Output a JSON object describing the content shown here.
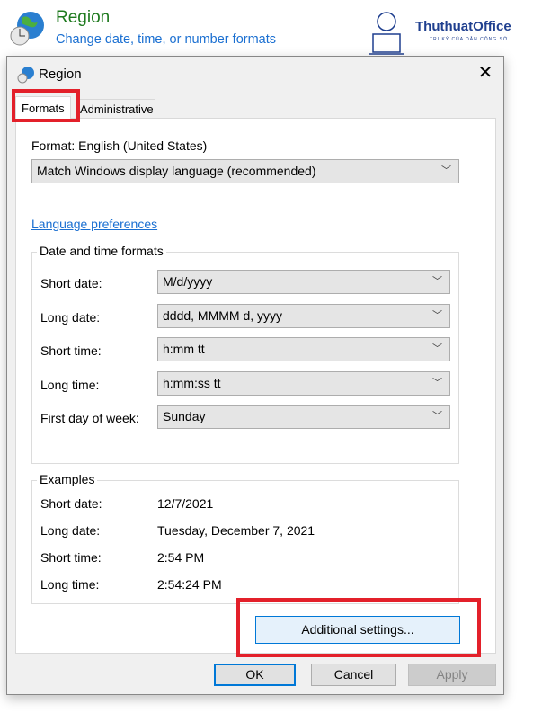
{
  "header": {
    "title": "Region",
    "subtitle": "Change date, time, or number formats",
    "icon": "globe-clock-icon"
  },
  "watermark": {
    "name": "ThuthuatOffice",
    "tagline": "TRI KỶ CỦA DÂN CÔNG SỞ"
  },
  "dialog": {
    "title": "Region",
    "close": "✕",
    "tabs": [
      {
        "label": "Formats",
        "active": true
      },
      {
        "label": "Administrative"
      }
    ],
    "format_label": "Format: English (United States)",
    "format_value": "Match Windows display language (recommended)",
    "language_link": "Language preferences",
    "date_time": {
      "title": "Date and time formats",
      "rows": [
        {
          "label": "Short date:",
          "value": "M/d/yyyy"
        },
        {
          "label": "Long date:",
          "value": "dddd, MMMM d, yyyy"
        },
        {
          "label": "Short time:",
          "value": "h:mm tt"
        },
        {
          "label": "Long time:",
          "value": "h:mm:ss tt"
        },
        {
          "label": "First day of week:",
          "value": "Sunday"
        }
      ]
    },
    "examples": {
      "title": "Examples",
      "rows": [
        {
          "label": "Short date:",
          "value": "12/7/2021"
        },
        {
          "label": "Long date:",
          "value": "Tuesday, December 7, 2021"
        },
        {
          "label": "Short time:",
          "value": "2:54 PM"
        },
        {
          "label": "Long time:",
          "value": "2:54:24 PM"
        }
      ]
    },
    "additional": "Additional settings...",
    "ok": "OK",
    "cancel": "Cancel",
    "apply": "Apply"
  },
  "colors": {
    "highlight": "#e3202a",
    "link": "#1a6fd1",
    "title_green": "#1e7a1e"
  }
}
